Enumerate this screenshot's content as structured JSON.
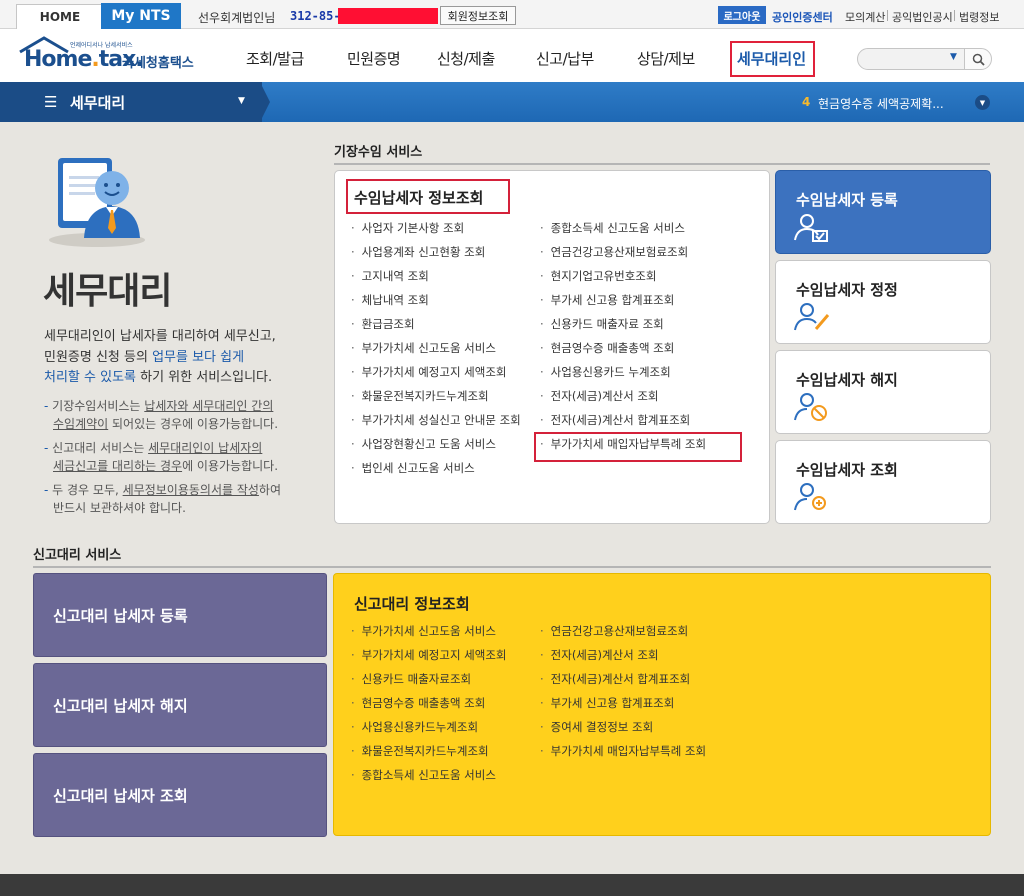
{
  "topbar": {
    "home_tab": "HOME",
    "mynts_tab": "My NTS",
    "user_greeting": "선우회계법인님",
    "biz_number": "312-85-",
    "member_info_button": "회원정보조회",
    "logout_button": "로그아웃",
    "cert_center_link": "공인인증센터",
    "utility_links": [
      "모의계산",
      "공익법인공시",
      "법령정보"
    ]
  },
  "header": {
    "logo_brand": "Hometax",
    "logo_small": "언제어디서나 납세서비스",
    "logo_kr": "국세청홈택스",
    "nav": [
      "조회/발급",
      "민원증명",
      "신청/제출",
      "신고/납부",
      "상담/제보"
    ],
    "nav_active": "세무대리인"
  },
  "menubar": {
    "title": "세무대리",
    "ticker_number": "4",
    "ticker_text": "현금영수증 세액공제확..."
  },
  "left": {
    "heading": "세무대리",
    "desc_line1": "세무대리인이 납세자를 대리하여 세무신고,",
    "desc_line2_a": "민원증명 신청 등의 ",
    "desc_line2_b": "업무를 보다 쉽게",
    "desc_line3_a": "처리할 수 있도록",
    "desc_line3_b": " 하기 위한 서비스입니다.",
    "bullet1_a": "기장수임서비스는 ",
    "bullet1_b": "납세자와 세무대리인 간의",
    "bullet1_c": "수임계약이",
    "bullet1_d": " 되어있는 경우에 이용가능합니다.",
    "bullet2_a": "신고대리 서비스는 ",
    "bullet2_b": "세무대리인이 납세자의",
    "bullet2_c": "세금신고를 대리하는 경우",
    "bullet2_d": "에 이용가능합니다.",
    "bullet3_a": "두 경우 모두, ",
    "bullet3_b": "세무정보이용동의서를 작성",
    "bullet3_c": "하여",
    "bullet3_d": "반드시 보관하셔야 합니다."
  },
  "bookkeeping": {
    "section_title": "기장수임 서비스",
    "panel_title": "수임납세자 정보조회",
    "col1": [
      "사업자 기본사항 조회",
      "사업용계좌 신고현황 조회",
      "고지내역 조회",
      "체납내역 조회",
      "환급금조회",
      "부가가치세 신고도움 서비스",
      "부가가치세 예정고지 세액조회",
      "화물운전복지카드누계조회",
      "부가가치세 성실신고 안내문 조회",
      "사업장현황신고 도움 서비스",
      "법인세 신고도움 서비스"
    ],
    "col2": [
      "종합소득세 신고도움 서비스",
      "연금건강고용산재보험료조회",
      "현지기업고유번호조회",
      "부가세 신고용 합계표조회",
      "신용카드 매출자료 조회",
      "현금영수증 매출총액 조회",
      "사업용신용카드 누계조회",
      "전자(세금)계산서 조회",
      "전자(세금)계산서 합계표조회",
      "부가가치세 매입자납부특례 조회"
    ],
    "side_buttons": [
      "수임납세자 등록",
      "수임납세자 정정",
      "수임납세자 해지",
      "수임납세자 조회"
    ]
  },
  "filing": {
    "section_title": "신고대리 서비스",
    "buttons": [
      "신고대리 납세자 등록",
      "신고대리 납세자 해지",
      "신고대리 납세자 조회"
    ],
    "panel_title": "신고대리 정보조회",
    "col1": [
      "부가가치세 신고도움 서비스",
      "부가가치세 예정고지 세액조회",
      "신용카드 매출자료조회",
      "현금영수증 매출총액 조회",
      "사업용신용카드누계조회",
      "화물운전복지카드누계조회",
      "종합소득세 신고도움 서비스"
    ],
    "col2": [
      "연금건강고용산재보험료조회",
      "전자(세금)계산서 조회",
      "전자(세금)계산서 합계표조회",
      "부가세 신고용 합계표조회",
      "증여세 결정정보 조회",
      "부가가치세 매입자납부특례 조회"
    ]
  },
  "colors": {
    "accent_blue": "#1f77c7",
    "highlight_red": "#d4213a",
    "purple": "#6b6896",
    "yellow": "#ffd01c"
  }
}
